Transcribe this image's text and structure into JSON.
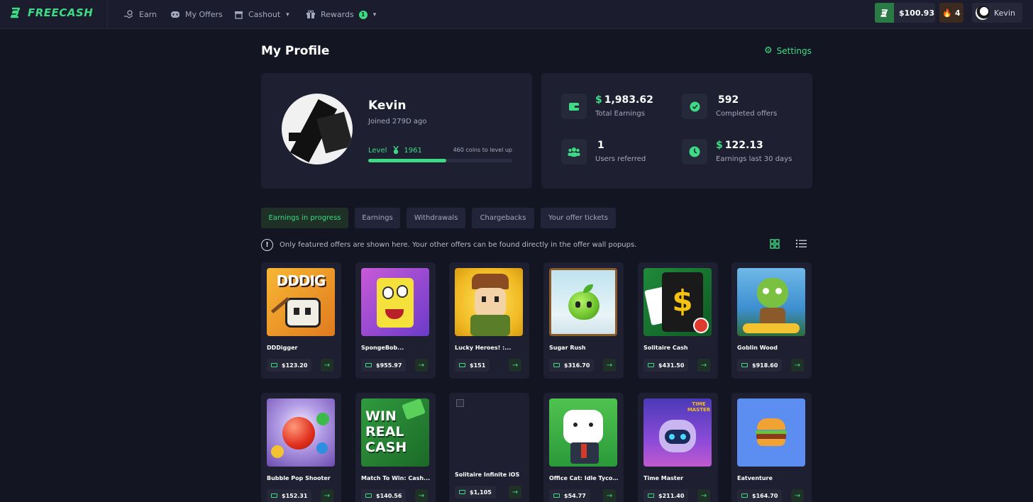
{
  "nav": {
    "brand": "FREECASH",
    "items": [
      {
        "label": "Earn",
        "icon": "hand-coin-icon"
      },
      {
        "label": "My Offers",
        "icon": "gamepad-icon"
      },
      {
        "label": "Cashout",
        "icon": "store-icon"
      },
      {
        "label": "Rewards",
        "icon": "gift-icon",
        "badge": "1"
      }
    ],
    "balance": "$100.93",
    "streak": "4",
    "username": "Kevin"
  },
  "page": {
    "title": "My Profile",
    "settings_label": "Settings"
  },
  "profile": {
    "name": "Kevin",
    "joined": "Joined 279D ago",
    "level_label": "Level",
    "level_value": "1961",
    "coins_to_level": "460 coins to level up",
    "level_progress": 0.54
  },
  "stats": [
    {
      "value": "1,983.62",
      "currency": "$",
      "label": "Total Earnings",
      "icon": "wallet-icon"
    },
    {
      "value": "592",
      "currency": "",
      "label": "Completed offers",
      "icon": "check-badge-icon"
    },
    {
      "value": "1",
      "currency": "",
      "label": "Users referred",
      "icon": "users-icon"
    },
    {
      "value": "122.13",
      "currency": "$",
      "label": "Earnings last 30 days",
      "icon": "clock-icon"
    }
  ],
  "tabs": [
    {
      "label": "Earnings in progress",
      "active": true
    },
    {
      "label": "Earnings",
      "active": false
    },
    {
      "label": "Withdrawals",
      "active": false
    },
    {
      "label": "Chargebacks",
      "active": false
    },
    {
      "label": "Your offer tickets",
      "active": false
    }
  ],
  "info_text": "Only featured offers are shown here. Your other offers can be found directly in the offer wall popups.",
  "offers": [
    {
      "name": "DDDigger",
      "price": "$123.20",
      "thumb_text": "DDDIG"
    },
    {
      "name": "SpongeBob...",
      "price": "$955.97",
      "thumb_text": ""
    },
    {
      "name": "Lucky Heroes! :...",
      "price": "$151",
      "thumb_text": ""
    },
    {
      "name": "Sugar Rush",
      "price": "$316.70",
      "thumb_text": ""
    },
    {
      "name": "Solitaire Cash",
      "price": "$431.50",
      "thumb_text": "$"
    },
    {
      "name": "Goblin Wood",
      "price": "$918.60",
      "thumb_text": ""
    },
    {
      "name": "Bubble Pop Shooter",
      "price": "$152.31",
      "thumb_text": ""
    },
    {
      "name": "Match To Win: Cash...",
      "price": "$140.56",
      "thumb_text": "WIN REAL CASH"
    },
    {
      "name": "Solitaire Infinite iOS",
      "price": "$1,105",
      "thumb_text": ""
    },
    {
      "name": "Office Cat: Idle Tycoo...",
      "price": "$54.77",
      "thumb_text": ""
    },
    {
      "name": "Time Master",
      "price": "$211.40",
      "thumb_text": "TIME MASTER"
    },
    {
      "name": "Eatventure",
      "price": "$164.70",
      "thumb_text": ""
    }
  ],
  "colors": {
    "accent": "#3ddc84",
    "background": "#141523",
    "card": "#1e2031"
  }
}
